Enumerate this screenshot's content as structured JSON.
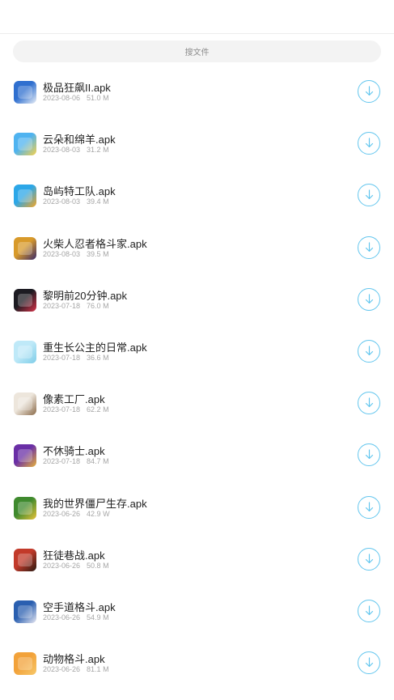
{
  "search": {
    "placeholder": "搜文件"
  },
  "files": [
    {
      "name": "极品狂飙II.apk",
      "date": "2023-08-06",
      "size": "51.0 M",
      "icon": "app-icon-racing",
      "colors": [
        "#2f6fcf",
        "#e9eef6"
      ]
    },
    {
      "name": "云朵和绵羊.apk",
      "date": "2023-08-03",
      "size": "31.2 M",
      "icon": "app-icon-cloud-sheep",
      "colors": [
        "#4fb3f0",
        "#f7d24a"
      ]
    },
    {
      "name": "岛屿特工队.apk",
      "date": "2023-08-03",
      "size": "39.4 M",
      "icon": "app-icon-island",
      "colors": [
        "#2ca7e8",
        "#f5a623"
      ]
    },
    {
      "name": "火柴人忍者格斗家.apk",
      "date": "2023-08-03",
      "size": "39.5 M",
      "icon": "app-icon-stickman",
      "colors": [
        "#d89a2a",
        "#3a2a6a"
      ]
    },
    {
      "name": "黎明前20分钟.apk",
      "date": "2023-07-18",
      "size": "76.0 M",
      "icon": "app-icon-dawn",
      "colors": [
        "#1c1b22",
        "#d8334a"
      ]
    },
    {
      "name": "重生长公主的日常.apk",
      "date": "2023-07-18",
      "size": "36.6 M",
      "icon": "app-icon-princess",
      "colors": [
        "#bfe9f8",
        "#7fcde8"
      ]
    },
    {
      "name": "像素工厂.apk",
      "date": "2023-07-18",
      "size": "62.2 M",
      "icon": "app-icon-pixel",
      "colors": [
        "#ede6dc",
        "#8b6b4a"
      ]
    },
    {
      "name": "不休骑士.apk",
      "date": "2023-07-18",
      "size": "84.7 M",
      "icon": "app-icon-knight",
      "colors": [
        "#6a2fa6",
        "#e8b23a"
      ]
    },
    {
      "name": "我的世界僵尸生存.apk",
      "date": "2023-06-26",
      "size": "42.9 W",
      "icon": "app-icon-zombie",
      "colors": [
        "#3f8a2e",
        "#e8c23a"
      ]
    },
    {
      "name": "狂徒巷战.apk",
      "date": "2023-06-26",
      "size": "50.8 M",
      "icon": "app-icon-street",
      "colors": [
        "#c23a2a",
        "#2a1a12"
      ]
    },
    {
      "name": "空手道格斗.apk",
      "date": "2023-06-26",
      "size": "54.9 M",
      "icon": "app-icon-karate",
      "colors": [
        "#2a5fb0",
        "#e8e8f2"
      ]
    },
    {
      "name": "动物格斗.apk",
      "date": "2023-06-26",
      "size": "81.1 M",
      "icon": "app-icon-animal",
      "colors": [
        "#f2a23a",
        "#f7c86a"
      ]
    }
  ],
  "accent": "#63c6ee"
}
